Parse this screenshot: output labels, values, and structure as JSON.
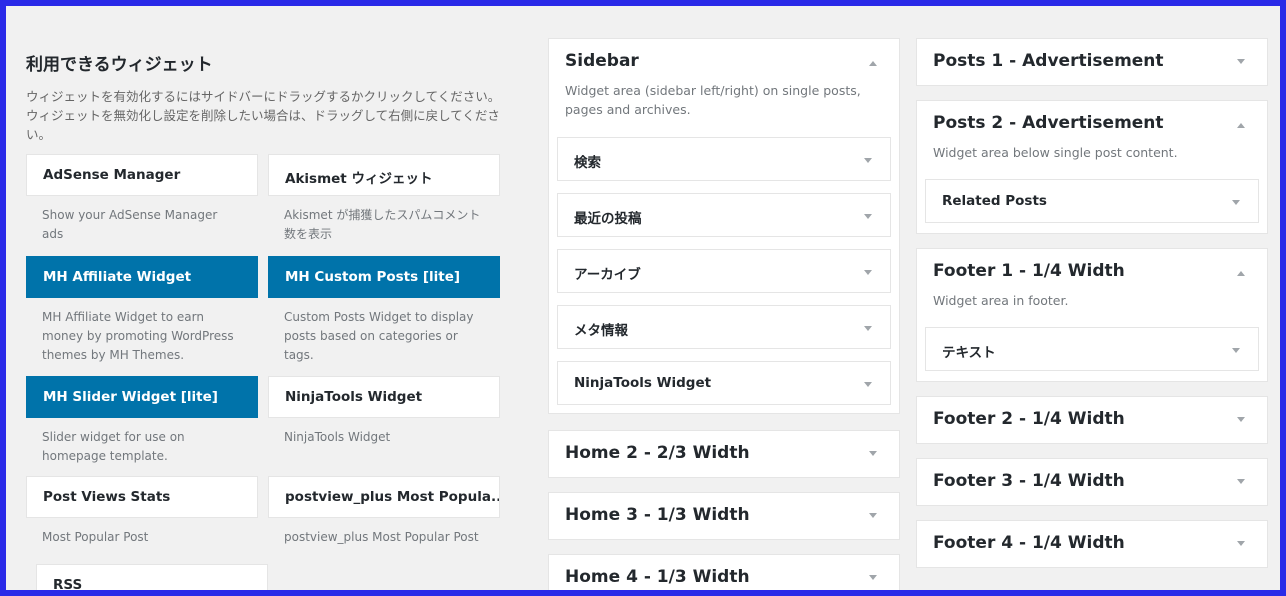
{
  "available": {
    "title": "利用できるウィジェット",
    "description": "ウィジェットを有効化するにはサイドバーにドラッグするかクリックしてください。ウィジェットを無効化し設定を削除したい場合は、ドラッグして右側に戻してください。",
    "widgets": [
      {
        "title": "AdSense Manager",
        "desc": "Show your AdSense Manager ads",
        "active": false
      },
      {
        "title": "Akismet ウィジェット",
        "desc": "Akismet が捕獲したスパムコメント数を表示",
        "active": false
      },
      {
        "title": "MH Affiliate Widget",
        "desc": "MH Affiliate Widget to earn money by promoting WordPress themes by MH Themes.",
        "active": true
      },
      {
        "title": "MH Custom Posts [lite]",
        "desc": "Custom Posts Widget to display posts based on categories or tags.",
        "active": true
      },
      {
        "title": "MH Slider Widget [lite]",
        "desc": "Slider widget for use on homepage template.",
        "active": true
      },
      {
        "title": "NinjaTools Widget",
        "desc": "NinjaTools Widget",
        "active": false
      },
      {
        "title": "Post Views Stats",
        "desc": "Most Popular Post",
        "active": false
      },
      {
        "title": "postview_plus Most Popula...",
        "desc": "postview_plus Most Popular Post",
        "active": false
      },
      {
        "title": "RSS",
        "desc": "",
        "active": false
      }
    ]
  },
  "sidebar_area": {
    "name": "Sidebar",
    "description": "Widget area (sidebar left/right) on single posts, pages and archives.",
    "widgets": [
      "検索",
      "最近の投稿",
      "アーカイブ",
      "メタ情報",
      "NinjaTools Widget"
    ]
  },
  "middle_areas": [
    "Home 2 - 2/3 Width",
    "Home 3 - 1/3 Width",
    "Home 4 - 1/3 Width"
  ],
  "right_areas": {
    "posts1": {
      "name": "Posts 1 - Advertisement"
    },
    "posts2": {
      "name": "Posts 2 - Advertisement",
      "description": "Widget area below single post content.",
      "widgets": [
        "Related Posts"
      ]
    },
    "footer1": {
      "name": "Footer 1 - 1/4 Width",
      "description": "Widget area in footer.",
      "widgets": [
        "テキスト"
      ]
    },
    "footer2": {
      "name": "Footer 2 - 1/4 Width"
    },
    "footer3": {
      "name": "Footer 3 - 1/4 Width"
    },
    "footer4": {
      "name": "Footer 4 - 1/4 Width"
    }
  },
  "colors": {
    "frame_border": "#2a2ae8",
    "active_widget": "#0073aa"
  },
  "icons": {
    "collapse": "arrow-up-icon",
    "expand": "arrow-down-icon"
  }
}
